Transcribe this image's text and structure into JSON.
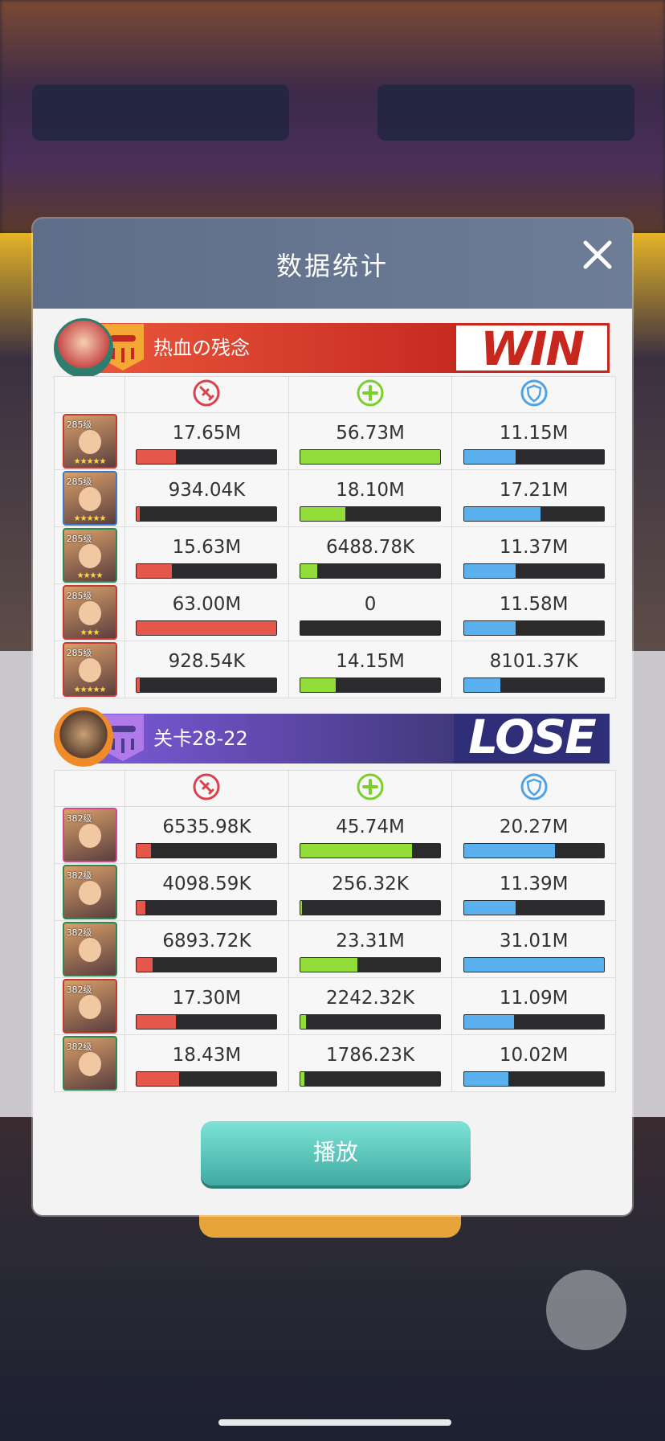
{
  "modal": {
    "title": "数据统计",
    "play_label": "播放"
  },
  "team1": {
    "name": "热血の残念",
    "result": "WIN",
    "heroes": [
      {
        "level": "285级",
        "stars": "★★★★★",
        "damage": "17.65M",
        "damage_frac": 0.28,
        "heal": "56.73M",
        "heal_frac": 1.0,
        "defense": "11.15M",
        "defense_frac": 0.37
      },
      {
        "level": "285级",
        "stars": "★★★★★",
        "damage": "934.04K",
        "damage_frac": 0.02,
        "heal": "18.10M",
        "heal_frac": 0.32,
        "defense": "17.21M",
        "defense_frac": 0.55
      },
      {
        "level": "285级",
        "stars": "★★★★",
        "damage": "15.63M",
        "damage_frac": 0.25,
        "heal": "6488.78K",
        "heal_frac": 0.12,
        "defense": "11.37M",
        "defense_frac": 0.37
      },
      {
        "level": "285级",
        "stars": "★★★",
        "damage": "63.00M",
        "damage_frac": 1.0,
        "heal": "0",
        "heal_frac": 0,
        "defense": "11.58M",
        "defense_frac": 0.37
      },
      {
        "level": "285级",
        "stars": "★★★★★",
        "damage": "928.54K",
        "damage_frac": 0.02,
        "heal": "14.15M",
        "heal_frac": 0.25,
        "defense": "8101.37K",
        "defense_frac": 0.26
      }
    ]
  },
  "team2": {
    "name": "关卡28-22",
    "result": "LOSE",
    "heroes": [
      {
        "level": "382级",
        "damage": "6535.98K",
        "damage_frac": 0.1,
        "heal": "45.74M",
        "heal_frac": 0.8,
        "defense": "20.27M",
        "defense_frac": 0.65
      },
      {
        "level": "382级",
        "damage": "4098.59K",
        "damage_frac": 0.06,
        "heal": "256.32K",
        "heal_frac": 0.01,
        "defense": "11.39M",
        "defense_frac": 0.37
      },
      {
        "level": "382级",
        "damage": "6893.72K",
        "damage_frac": 0.11,
        "heal": "23.31M",
        "heal_frac": 0.41,
        "defense": "31.01M",
        "defense_frac": 1.0
      },
      {
        "level": "382级",
        "damage": "17.30M",
        "damage_frac": 0.28,
        "heal": "2242.32K",
        "heal_frac": 0.04,
        "defense": "11.09M",
        "defense_frac": 0.36
      },
      {
        "level": "382级",
        "damage": "18.43M",
        "damage_frac": 0.3,
        "heal": "1786.23K",
        "heal_frac": 0.03,
        "defense": "10.02M",
        "defense_frac": 0.32
      }
    ]
  },
  "icons": {
    "damage": "sword-icon",
    "heal": "plus-icon",
    "defense": "shield-icon",
    "close": "close-icon"
  },
  "colors": {
    "damage": "#e6574b",
    "heal": "#93dd3b",
    "defense": "#5bb0ee",
    "win": "#c8271e",
    "lose_bg": "#2e2f78",
    "header": "#5e6e89",
    "play_button": "#58c5bc"
  }
}
